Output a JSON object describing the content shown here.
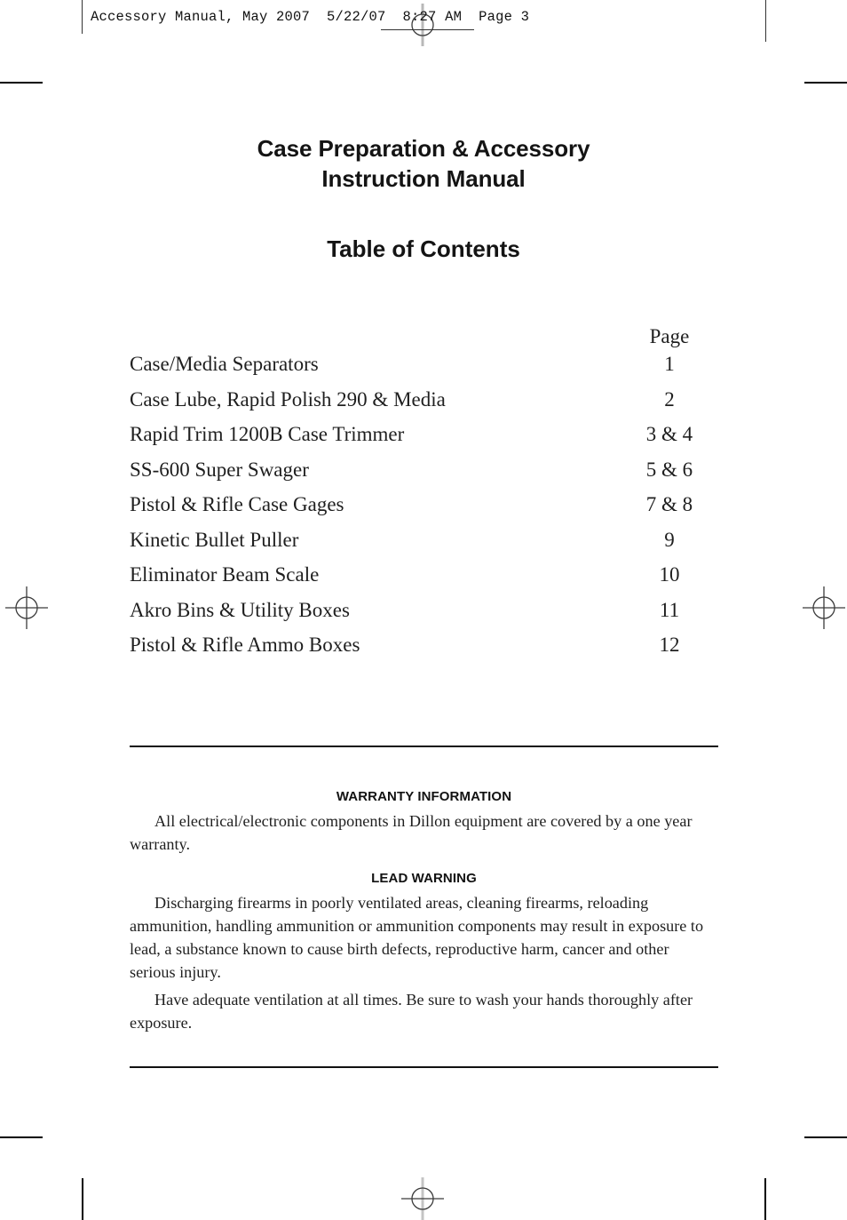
{
  "press": {
    "slug_text": "Accessory Manual, May 2007  5/22/07  8:27 AM  Page 3",
    "registration_mark_name": "registration-target"
  },
  "document": {
    "title_lines": [
      "Case Preparation & Accessory",
      "Instruction Manual"
    ],
    "toc_heading": "Table of Contents",
    "toc": {
      "page_column_label": "Page",
      "entries": [
        {
          "title": "Case/Media Separators",
          "page": "1"
        },
        {
          "title": "Case Lube, Rapid Polish 290 & Media",
          "page": "2"
        },
        {
          "title": "Rapid Trim 1200B Case Trimmer",
          "page": "3 & 4"
        },
        {
          "title": "SS-600 Super Swager",
          "page": "5 & 6"
        },
        {
          "title": "Pistol & Rifle Case Gages",
          "page": "7 & 8"
        },
        {
          "title": "Kinetic Bullet Puller",
          "page": "9"
        },
        {
          "title": "Eliminator Beam Scale",
          "page": "10"
        },
        {
          "title": "Akro Bins & Utility Boxes",
          "page": "11"
        },
        {
          "title": "Pistol & Rifle Ammo Boxes",
          "page": "12"
        }
      ]
    },
    "notices": {
      "warranty_heading": "WARRANTY INFORMATION",
      "warranty_text": "All electrical/electronic components in Dillon equipment are covered by a one year warranty.",
      "lead_heading": "LEAD WARNING",
      "lead_text_1": "Discharging firearms in poorly ventilated areas, cleaning firearms, reloading ammunition, handling ammunition or ammunition components may result in exposure to lead, a substance known to cause birth defects, reproductive harm, cancer and other serious injury.",
      "lead_text_2": "Have adequate ventilation at all times. Be sure to wash your hands thoroughly after exposure."
    }
  },
  "colors": {
    "ink": "#1a1a1a",
    "rule": "#111111",
    "paper": "#ffffff"
  }
}
